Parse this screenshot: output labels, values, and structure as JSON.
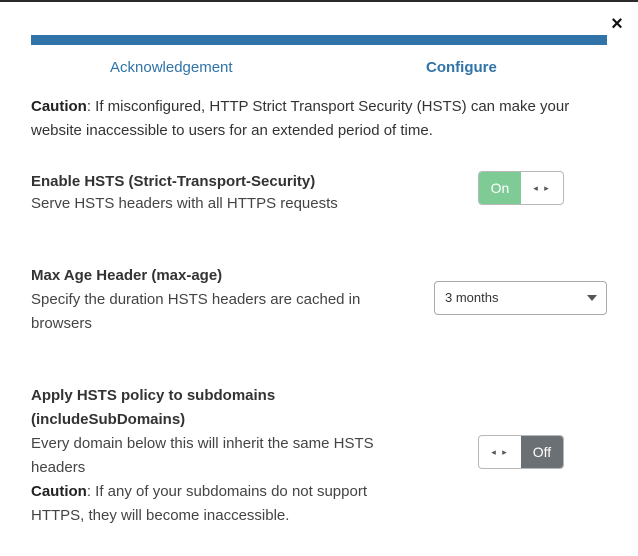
{
  "modal": {
    "close_glyph": "×"
  },
  "steps": {
    "acknowledgement": "Acknowledgement",
    "configure": "Configure"
  },
  "intro": {
    "caution_label": "Caution",
    "caution_text": ": If misconfigured, HTTP Strict Transport Security (HSTS) can make your website inaccessible to users for an extended period of time."
  },
  "settings": {
    "enable_hsts": {
      "title": "Enable HSTS (Strict-Transport-Security)",
      "description": "Serve HSTS headers with all HTTPS requests",
      "toggle_state_label": "On",
      "handle_glyph": "◂ ▸"
    },
    "max_age": {
      "title": "Max Age Header (max-age)",
      "description": "Specify the duration HSTS headers are cached in browsers",
      "selected_option": "3 months"
    },
    "subdomains": {
      "title": "Apply HSTS policy to subdomains (includeSubDomains)",
      "description": "Every domain below this will inherit the same HSTS headers",
      "caution_label": "Caution",
      "caution_text": ": If any of your subdomains do not support HTTPS, they will become inaccessible.",
      "toggle_state_label": "Off",
      "handle_glyph": "◂ ▸"
    }
  },
  "colors": {
    "accent": "#2f73a8",
    "toggle_on": "#7ecb96",
    "toggle_off": "#6b7075"
  }
}
